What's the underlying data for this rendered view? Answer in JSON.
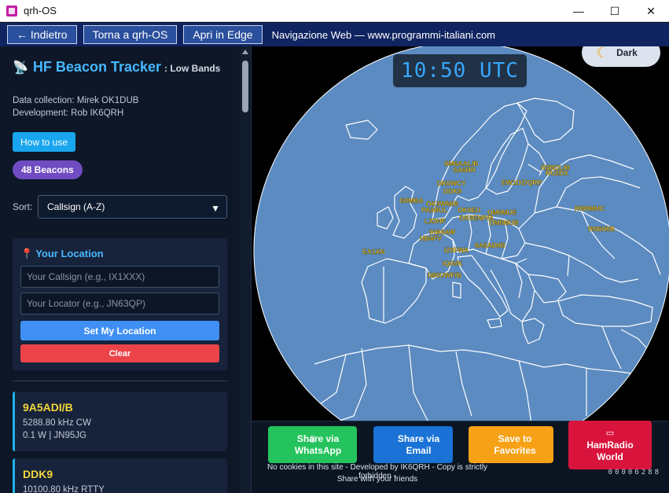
{
  "window": {
    "title": "qrh-OS",
    "controls": [
      "—",
      "☐",
      "✕"
    ]
  },
  "navbar": {
    "back_label": "← Indietro",
    "home_label": "Torna a qrh-OS",
    "edge_label": "Apri in Edge",
    "caption": "Navigazione Web — www.programmi-italiani.com"
  },
  "sidebar": {
    "title": "HF Beacon Tracker",
    "subtitle": ": Low Bands",
    "credit_collection": "Data collection: Mirek OK1DUB",
    "credit_development": "Development: Rob IK6QRH",
    "howto_label": "How to use",
    "beacons_badge": "48 Beacons",
    "sort_label": "Sort:",
    "sort_value": "Callsign (A-Z)",
    "location": {
      "title": "Your Location",
      "callsign_placeholder": "Your Callsign (e.g., IX1XXX)",
      "locator_placeholder": "Your Locator (e.g., JN63QP)",
      "set_label": "Set My Location",
      "clear_label": "Clear"
    },
    "beacons": [
      {
        "call": "9A5ADI/B",
        "freq": "5288.80 kHz CW",
        "info": "0.1 W | JN95JG"
      },
      {
        "call": "DDK9",
        "freq": "10100.80 kHz RTTY",
        "info": ""
      }
    ]
  },
  "map": {
    "clock": "10:50 UTC",
    "theme_label": "Dark",
    "colors": {
      "sea": "#5b8bc1",
      "land_border": "#ffffff",
      "labels": "#f2d63a"
    },
    "labels": [
      "SM6AAL/B",
      "SA6RR",
      "R3BDL/B",
      "RU2DX",
      "DK0WCY",
      "DDK9",
      "EW1OZ/QRP",
      "G0MBA",
      "OK3WM/B",
      "PA3BUL",
      "OK0EU",
      "OM0MUE",
      "RW6MHC",
      "OK0ENP/B",
      "OM0MUB",
      "LX0HF",
      "RN6HI/B",
      "IHB9AW",
      "HB4FV",
      "9A5ADI/B",
      "IZ0FWA",
      "EA1XN",
      "IQ5VK",
      "IW0UWF/B"
    ],
    "share": {
      "whatsapp": "Share via WhatsApp",
      "email": "Share via Email",
      "favorites": "Save to Favorites",
      "hamradio": "HamRadio World"
    },
    "footer_line1": "No cookies in this site - Developed by IK6QRH - Copy is strictly forbidden -",
    "footer_line2": "Share with your friends",
    "counter": "00006288"
  }
}
